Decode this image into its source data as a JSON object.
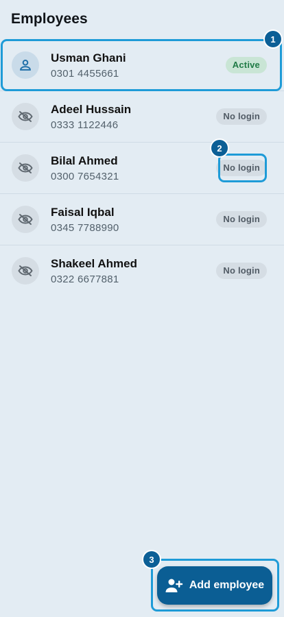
{
  "header": {
    "title": "Employees"
  },
  "employees": [
    {
      "name": "Usman Ghani",
      "phone": "0301 4455661",
      "status": "Active",
      "icon": "person-icon"
    },
    {
      "name": "Adeel Hussain",
      "phone": "0333 1122446",
      "status": "No login",
      "icon": "visibility-off-icon"
    },
    {
      "name": "Bilal Ahmed",
      "phone": "0300 7654321",
      "status": "No login",
      "icon": "visibility-off-icon"
    },
    {
      "name": "Faisal Iqbal",
      "phone": "0345 7788990",
      "status": "No login",
      "icon": "visibility-off-icon"
    },
    {
      "name": "Shakeel Ahmed",
      "phone": "0322 6677881",
      "status": "No login",
      "icon": "visibility-off-icon"
    }
  ],
  "fab": {
    "label": "Add employee",
    "icon": "person-add-icon"
  },
  "annotations": {
    "m1": "1",
    "m2": "2",
    "m3": "3"
  },
  "colors": {
    "background": "#e3ecf3",
    "accent": "#0b5e94",
    "highlight": "#1e9bd7",
    "active_badge_bg": "#c9e5d5",
    "active_badge_text": "#1f7a45",
    "nologin_badge_bg": "#d5dde4"
  }
}
